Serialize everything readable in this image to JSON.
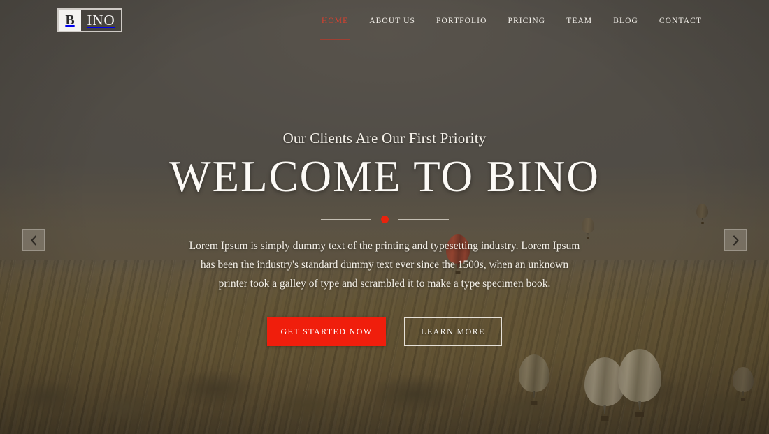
{
  "site": {
    "logo": {
      "first": "B",
      "rest": "INO",
      "alt": "BINO"
    }
  },
  "nav": {
    "items": [
      {
        "label": "HOME",
        "active": true
      },
      {
        "label": "ABOUT US",
        "active": false
      },
      {
        "label": "PORTFOLIO",
        "active": false
      },
      {
        "label": "PRICING",
        "active": false
      },
      {
        "label": "TEAM",
        "active": false
      },
      {
        "label": "BLOG",
        "active": false
      },
      {
        "label": "CONTACT",
        "active": false
      }
    ]
  },
  "hero": {
    "tagline": "Our Clients Are Our First Priority",
    "headline": "WELCOME TO BINO",
    "body": "Lorem Ipsum is simply dummy text of the printing and typesetting industry. Lorem Ipsum has been the industry's standard dummy text ever since the 1500s, when an unknown printer took a galley of type and scrambled it to make a type specimen book.",
    "primary_cta": "GET STARTED NOW",
    "secondary_cta": "LEARN MORE"
  },
  "carousel": {
    "prev_icon": "chevron-left-icon",
    "next_icon": "chevron-right-icon"
  },
  "colors": {
    "accent_red": "#f01e0c",
    "nav_active_red": "#d8402e",
    "divider_dot": "#e8230e",
    "text_light": "#f6f2ea",
    "sky": "#565350",
    "ground": "#6e5c36"
  }
}
